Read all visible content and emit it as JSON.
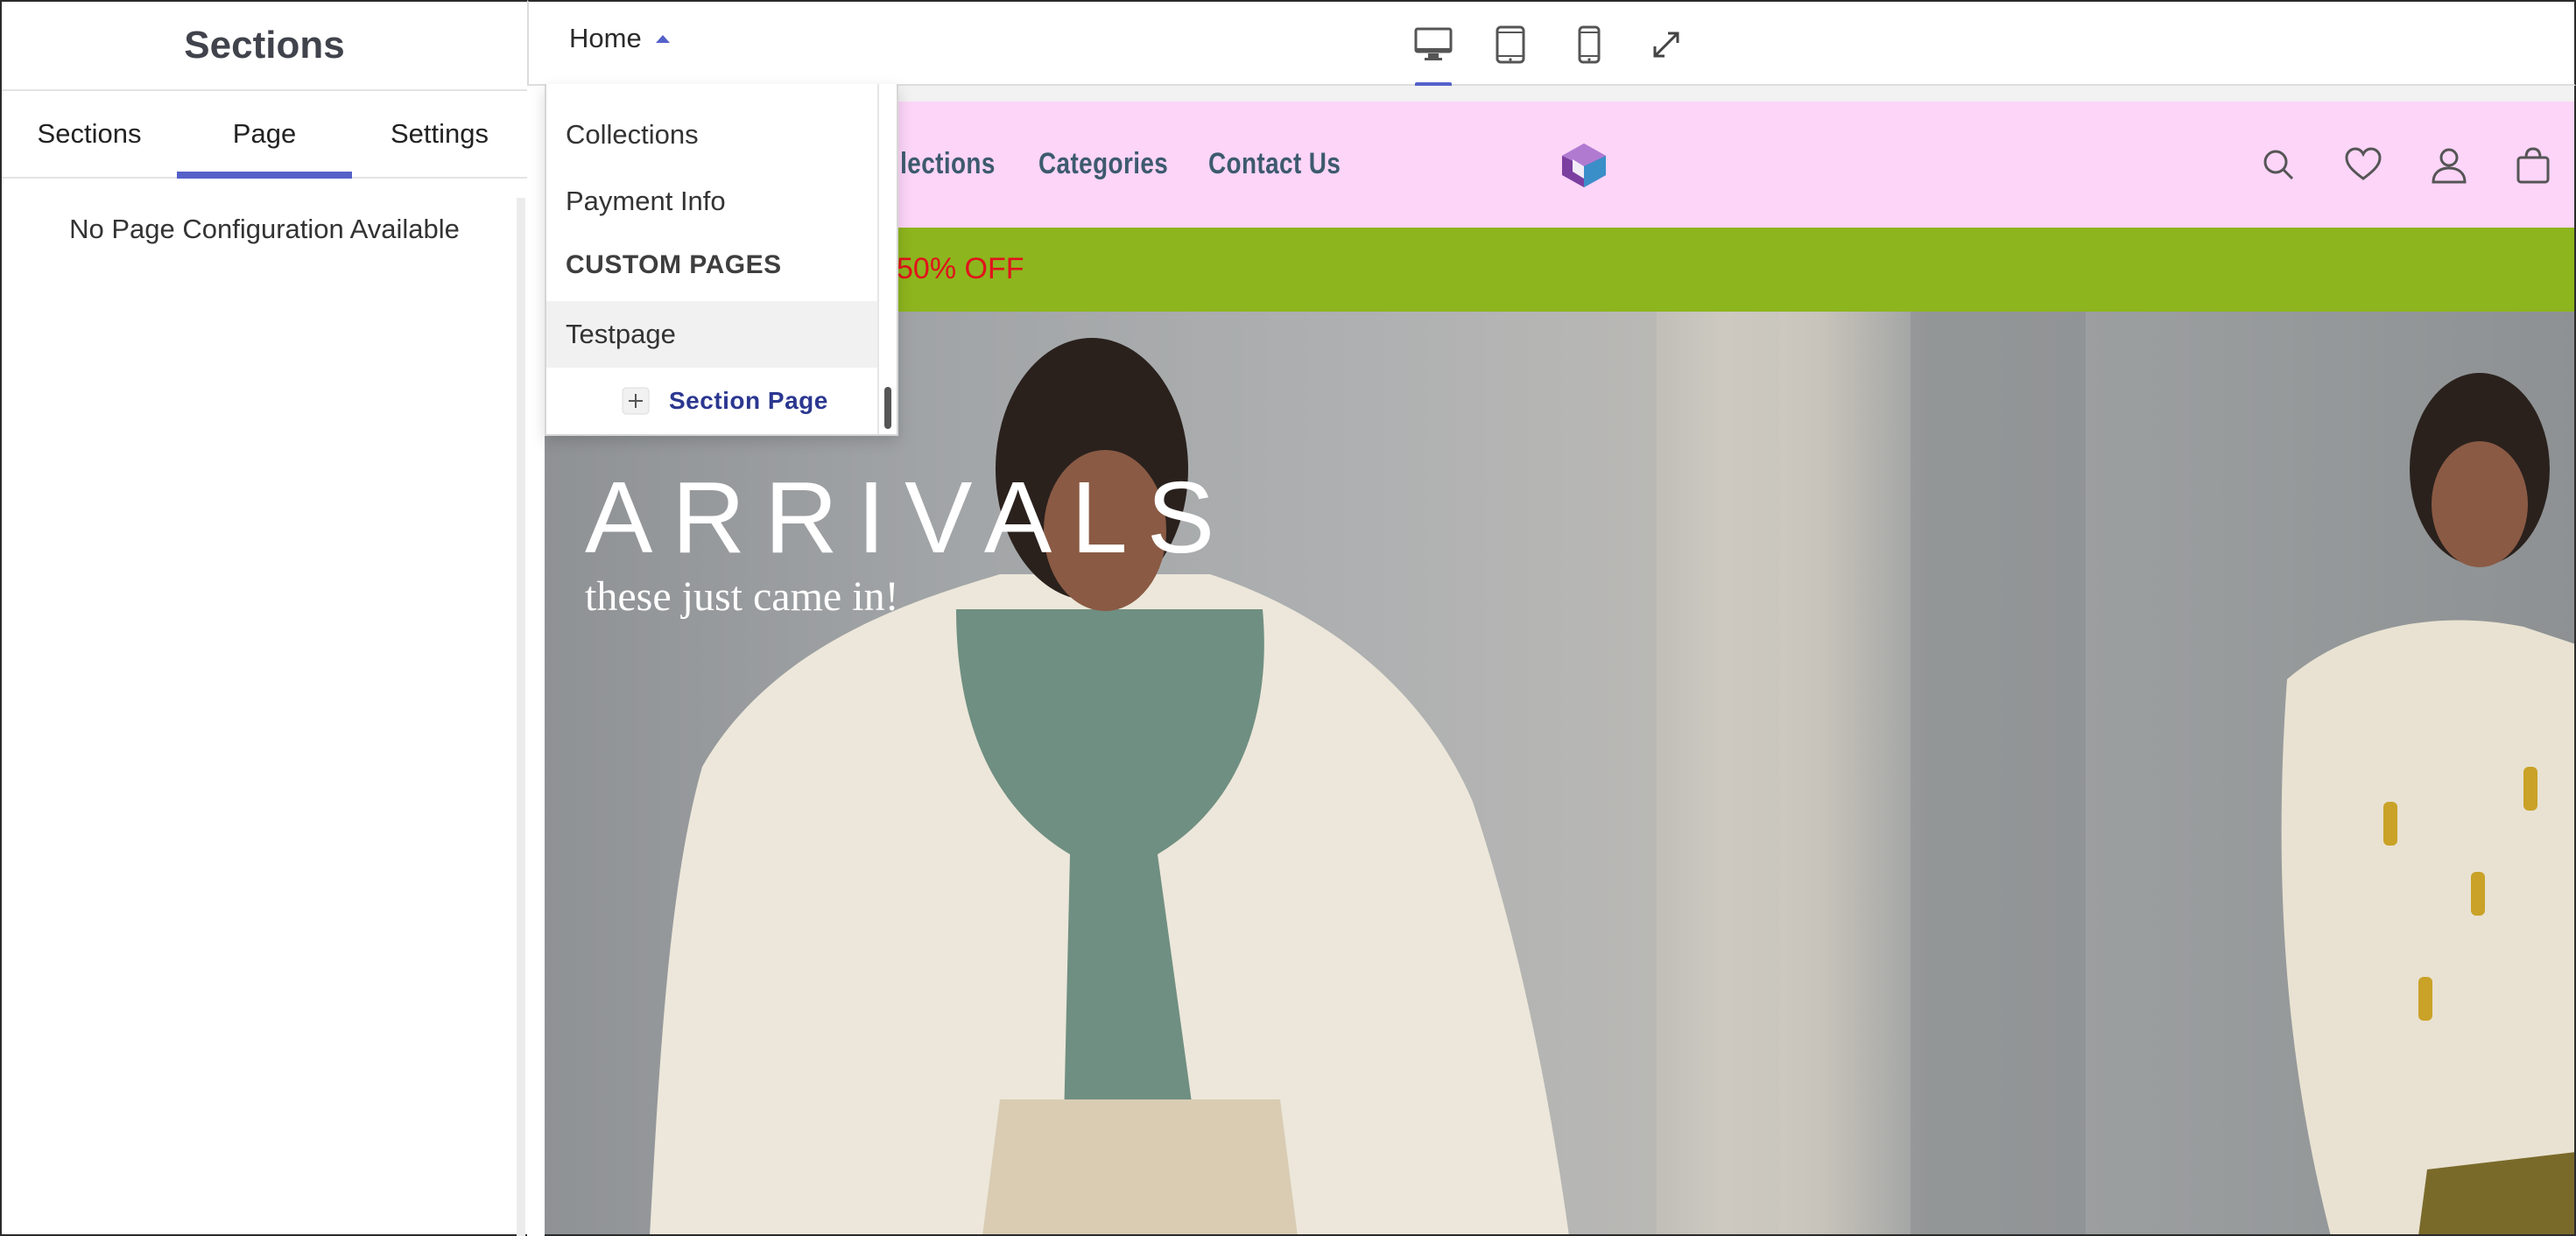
{
  "sidebar": {
    "title": "Sections",
    "tabs": [
      {
        "label": "Sections"
      },
      {
        "label": "Page"
      },
      {
        "label": "Settings"
      }
    ],
    "active_tab": "Page",
    "empty_message": "No Page Configuration Available"
  },
  "topbar": {
    "page_selector": "Home",
    "devices": [
      "desktop-icon",
      "tablet-icon",
      "mobile-icon",
      "expand-icon"
    ],
    "active_device": "desktop"
  },
  "dropdown": {
    "items": [
      {
        "label": "Collections"
      },
      {
        "label": "Payment Info"
      }
    ],
    "custom_heading": "CUSTOM PAGES",
    "custom_items": [
      {
        "label": "Testpage"
      }
    ],
    "selected": "Testpage",
    "add_label": "Section Page"
  },
  "preview": {
    "nav": [
      {
        "label": "Collections"
      },
      {
        "label": "Categories"
      },
      {
        "label": "Contact Us"
      }
    ],
    "header_icons": [
      "search-icon",
      "heart-icon",
      "user-icon",
      "cart-icon"
    ],
    "promo_text": "50% OFF",
    "hero_title": "ARRIVALS",
    "hero_subtitle": "these just came in!",
    "colors": {
      "accent": "#5561c9",
      "header_bg": "#fcd5f8",
      "promo_bg": "#8db51e",
      "promo_text": "#e1121b",
      "nav_text": "#3d5a6e",
      "add_link": "#2b3790"
    }
  }
}
